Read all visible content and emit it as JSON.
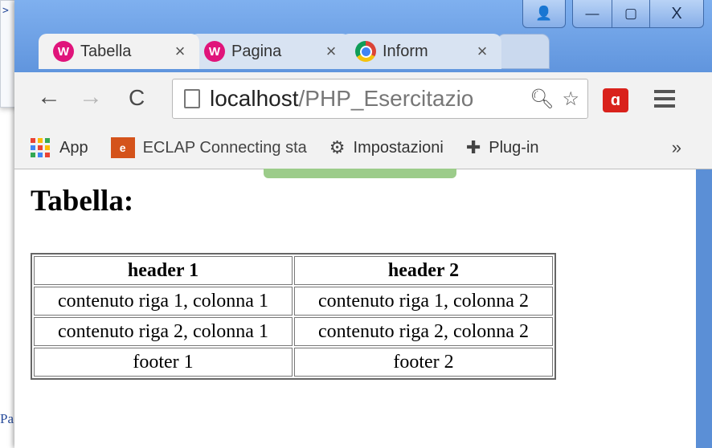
{
  "background": {
    "chevron": ">",
    "fragment": "Pa"
  },
  "window_controls": {
    "user": "👤",
    "minimize": "—",
    "maximize": "▢",
    "close": "X"
  },
  "tabs": [
    {
      "title": "Tabella",
      "close": "×"
    },
    {
      "title": "Pagina",
      "close": "×"
    },
    {
      "title": "Inform",
      "close": "×"
    }
  ],
  "toolbar": {
    "back": "←",
    "forward": "→",
    "reload": "C",
    "url_host": "localhost",
    "url_path": "/PHP_Esercitazio",
    "zoom_icon": "🔍︎",
    "star": "☆",
    "avira": "ɑ"
  },
  "bookmarks": [
    {
      "label": "App"
    },
    {
      "label": "ECLAP Connecting sta"
    },
    {
      "label": "Impostazioni"
    },
    {
      "label": "Plug-in"
    }
  ],
  "bookmarks_more": "»",
  "page": {
    "title": "Tabella:",
    "table": {
      "headers": [
        "header 1",
        "header 2"
      ],
      "rows": [
        [
          "contenuto riga 1, colonna 1",
          "contenuto riga 1, colonna 2"
        ],
        [
          "contenuto riga 2, colonna 1",
          "contenuto riga 2, colonna 2"
        ]
      ],
      "footer": [
        "footer 1",
        "footer 2"
      ]
    }
  }
}
